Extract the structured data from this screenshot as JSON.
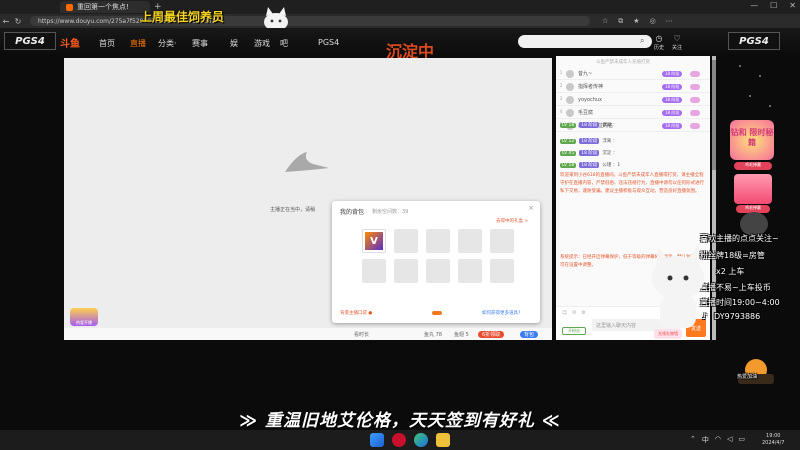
{
  "browser": {
    "tab_title": "重回第一个焦点!",
    "new_tab": "+",
    "url": "https://www.douyu.com/275a7f5295938a8ee1cd00831681",
    "win_min": "—",
    "win_max": "☐",
    "win_close": "✕"
  },
  "overlay_banner": "上周最佳饲养员",
  "site": {
    "logo_left": "PGS4",
    "logo_right": "PGS4",
    "douyu_logo": "斗鱼",
    "nav": {
      "home": "首页",
      "live": "直播",
      "category": "分类·",
      "match": "赛事",
      "yule": "娱",
      "game": "游戏",
      "b": "吧",
      "pgs": "PGS4"
    },
    "live_status": "沉淀中",
    "header_icons": [
      "历史",
      "关注"
    ]
  },
  "player": {
    "offline_msg": "主播正在当中，请稍",
    "anchor_badge": "热爱开播",
    "bar": {
      "item1": "看时长",
      "item2": "鱼丸 78",
      "item3": "鱼翅 5",
      "item4": "6折领取",
      "item5": "背包"
    }
  },
  "backpack": {
    "title": "我的背包",
    "capacity": "剩余空间数：39",
    "gift_btn": "去得中的礼盒 >",
    "footer_left": "背景主播口袋 ●",
    "footer_right": "如何获得更多道具?",
    "close": "×"
  },
  "chat": {
    "rank_title": "斗鱼严禁未成年人充值打赏",
    "rank": [
      {
        "num": "1",
        "name": "昔九~",
        "badge": "18 阶段"
      },
      {
        "num": "2",
        "name": "指挥者传神",
        "badge": "18 阶段"
      },
      {
        "num": "3",
        "name": "yoyochux",
        "badge": "18 阶段"
      },
      {
        "num": "4",
        "name": "毛豆腐",
        "badge": "18 阶段"
      },
      {
        "num": "5",
        "name": "最佳第一位的名",
        "badge": "18 阶段"
      }
    ],
    "messages": [
      {
        "lv": "LV 18",
        "fan": "18 阶段",
        "text": "偶骊 ："
      },
      {
        "lv": "LV 12",
        "fan": "18 阶段",
        "text": "浮离 ："
      },
      {
        "lv": "LV 45",
        "fan": "18 阶段",
        "text": "沉淀 ："
      },
      {
        "lv": "LV 18",
        "fan": "18 阶段",
        "text": "公瑾 ：1"
      }
    ],
    "system_msg": "欢迎来到小谷618的直播间。斗鱼严禁未成年人直播或打赏，请主播全程守护在直播内容，严禁低俗、违法违规行为，直播中请勿以任何形式进行私下交易，谨防受骗。建议主播积极与观众互动，营造良好直播氛围。",
    "system_msg2": "系统提示：已经开启弹幕保护，低于等级的弹幕将不显示，默认为灰色，可在设置中调整。",
    "input_placeholder": "这里输入聊天内容",
    "send": "发送",
    "fan_btn": "开粉丝",
    "gift_wall": "光领礼物墙"
  },
  "right_overlay": {
    "welcome": "喜欢主播的点点关注~",
    "fan_rule": "粉丝牌18级=房管",
    "x2": "x2 上车",
    "tip": "直播不易~上车投币",
    "time": "直播时间19:00~4:00",
    "dy": "DY9793886",
    "promo_card1": "钻和 限时秘籍",
    "promo_card1_foot": "鸡毛掸赢",
    "promo_card2_foot": "鸡毛掸赢",
    "game_badge": "热爱加油"
  },
  "slogan": "≫ 重温旧地艾伦格，天天签到有好礼 ≪",
  "taskbar": {
    "lang": "中",
    "clock_time": "19:00",
    "clock_date": "2024/4/7"
  },
  "colors": {
    "accent_orange": "#ff7a1f",
    "banner_yellow": "#f6d31f",
    "live_red": "#d94a1e"
  }
}
